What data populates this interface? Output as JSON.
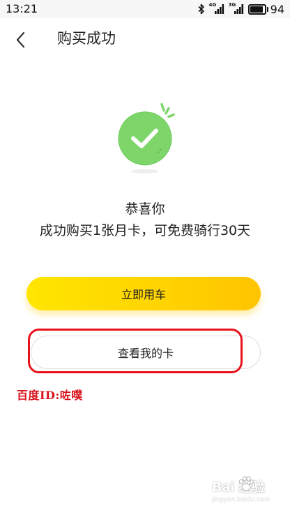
{
  "status_bar": {
    "time": "13:21",
    "network_1": "4G",
    "network_2": "3G",
    "battery_percent": "94",
    "battery_level": 0.94,
    "icons": [
      "bluetooth-icon",
      "signal-icon",
      "signal-icon",
      "battery-icon"
    ]
  },
  "header": {
    "back_icon": "chevron-left-icon",
    "title": "购买成功"
  },
  "success": {
    "icon": "check-circle-icon",
    "heading": "恭喜你",
    "detail": "成功购买1张月卡，可免费骑行30天"
  },
  "actions": {
    "primary_label": "立即用车",
    "secondary_label": "查看我的卡"
  },
  "annotation": {
    "text": "百度ID:咗噗"
  },
  "watermark": {
    "brand": "Bai  经验",
    "url": "jingyan.baidu.com"
  },
  "colors": {
    "accent_yellow": "#FFD800",
    "success_green": "#7ED66A",
    "annotation_red": "#E8121B"
  }
}
